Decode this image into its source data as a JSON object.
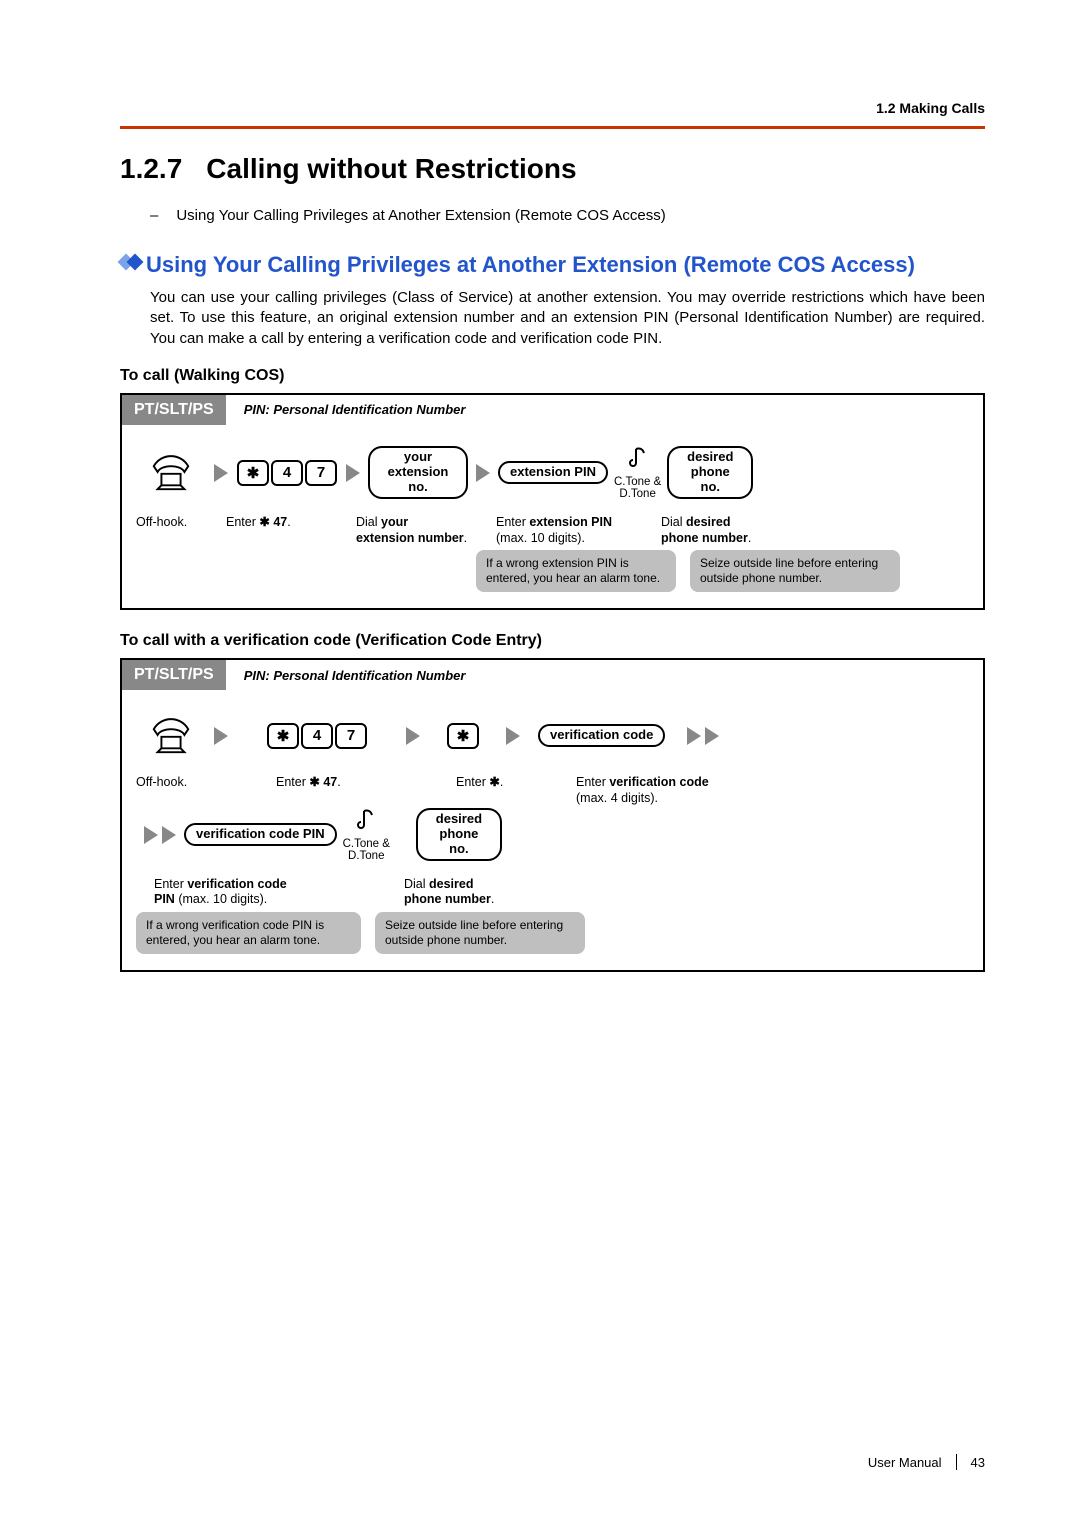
{
  "header": {
    "breadcrumb": "1.2 Making Calls"
  },
  "title": {
    "number": "1.2.7",
    "text": "Calling without Restrictions"
  },
  "toc_line": "Using Your Calling Privileges at Another Extension (Remote COS Access)",
  "subsection": "Using Your Calling Privileges at Another Extension (Remote COS Access)",
  "paragraph": "You can use your calling privileges (Class of Service) at another extension. You may override restrictions which have been set. To use this feature, an original extension number and an extension PIN (Personal Identification Number) are required. You can make a call by entering a verification code and verification code PIN.",
  "heading1": "To call (Walking COS)",
  "heading2": "To call with a verification code (Verification Code Entry)",
  "device_tag": "PT/SLT/PS",
  "pin_note": "PIN: Personal Identification Number",
  "keys": {
    "star": "✱",
    "four": "4",
    "seven": "7"
  },
  "bubbles": {
    "your_ext": "your\nextension no.",
    "ext_pin": "extension PIN",
    "desired": "desired\nphone no.",
    "ver_code": "verification code",
    "ver_pin": "verification code PIN"
  },
  "tone": "C.Tone &\nD.Tone",
  "captions": {
    "offhook": "Off-hook.",
    "enter47_a": "Enter ",
    "enter47_b": "✱",
    "enter47_c": "47",
    "dial_ext_a": "Dial ",
    "dial_ext_b": "your",
    "dial_ext_c": "extension number",
    "enter_pin_a": "Enter ",
    "enter_pin_b": "extension PIN",
    "enter_pin_c": "(max. 10 digits).",
    "dial_phone_a": "Dial ",
    "dial_phone_b": "desired",
    "dial_phone_c": "phone number",
    "enter_star_a": "Enter ",
    "enter_star_b": "✱",
    "enter_vc_a": "Enter ",
    "enter_vc_b": "verification code",
    "enter_vc_c": "(max. 4 digits).",
    "enter_vcp_a": "Enter ",
    "enter_vcp_b": "verification code",
    "enter_vcp_c": "PIN",
    "enter_vcp_d": " (max. 10 digits)."
  },
  "notes": {
    "wrong_ext_pin": "If a wrong extension PIN is entered, you hear an alarm tone.",
    "seize": "Seize outside line before entering outside phone number.",
    "wrong_vc_pin": "If a wrong verification code PIN is entered, you hear an alarm tone."
  },
  "footer": {
    "label": "User Manual",
    "page": "43"
  }
}
